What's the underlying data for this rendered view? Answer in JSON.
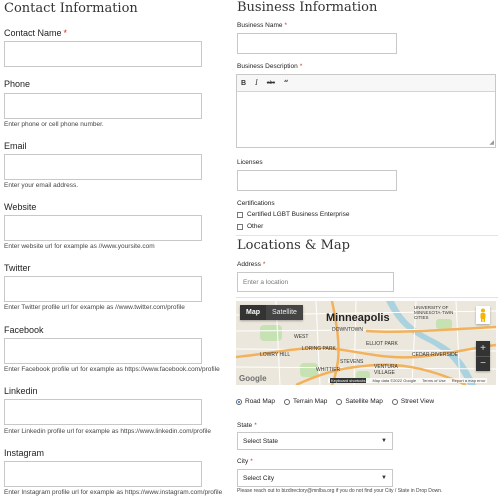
{
  "contact": {
    "heading": "Contact Information",
    "fields": [
      {
        "key": "name",
        "label": "Contact Name",
        "required": true,
        "help": ""
      },
      {
        "key": "phone",
        "label": "Phone",
        "required": false,
        "help": "Enter phone or cell phone number."
      },
      {
        "key": "email",
        "label": "Email",
        "required": false,
        "help": "Enter your email address."
      },
      {
        "key": "website",
        "label": "Website",
        "required": false,
        "help": "Enter website url for example as //www.yoursite.com"
      },
      {
        "key": "twitter",
        "label": "Twitter",
        "required": false,
        "help": "Enter Twitter profile url for example as //www.twitter.com/profile"
      },
      {
        "key": "facebook",
        "label": "Facebook",
        "required": false,
        "help": "Enter Facebook profile url for example as https://www.facebook.com/profile"
      },
      {
        "key": "linkedin",
        "label": "Linkedin",
        "required": false,
        "help": "Enter Linkedin profile url for example as https://www.linkedin.com/profile"
      },
      {
        "key": "instagram",
        "label": "Instagram",
        "required": false,
        "help": "Enter Instagram profile url for example as https://www.instagram.com/profile"
      }
    ]
  },
  "business": {
    "heading": "Business Information",
    "name_label": "Business Name",
    "description_label": "Business Description",
    "toolbar": {
      "bold": "B",
      "italic": "I",
      "strike": "abc",
      "quote": "66"
    },
    "licenses_label": "Licenses",
    "certifications_label": "Certifications",
    "certifications": [
      "Certified LGBT Business Enterprise",
      "Other"
    ]
  },
  "location": {
    "heading": "Locations & Map",
    "address_label": "Address",
    "address_placeholder": "Enter a location",
    "map": {
      "tab_map": "Map",
      "tab_satellite": "Satellite",
      "city": "Minneapolis",
      "places": [
        "DOWNTOWN",
        "WEST",
        "ELLIOT PARK",
        "LORING PARK",
        "LOWRY HILL",
        "CEDAR-RIVERSIDE",
        "UNIVERSITY OF MINNESOTA-TWIN CITIES",
        "MINNESOTA TWIN CITIES",
        "STEVENS",
        "WHITTIER",
        "VENTURA VILLAGE"
      ],
      "footer": [
        "Keyboard shortcuts",
        "Map data ©2022 Google",
        "Terms of Use",
        "Report a map error"
      ],
      "google": "Google",
      "zoom_in": "+",
      "zoom_out": "−"
    },
    "map_types": [
      "Road Map",
      "Terrain Map",
      "Satellite Map",
      "Street View"
    ],
    "map_type_selected": "Road Map",
    "state_label": "State",
    "state_value": "Select State",
    "city_label": "City",
    "city_value": "Select City",
    "city_help": "Please reach out to bizdirectory@mnlba.org if you do not find your City / State in Drop Down."
  },
  "colors": {
    "required": "#c0392b",
    "map_water": "#aad3df",
    "map_highway": "#f3b15b",
    "map_land": "#e8e4d8",
    "map_park": "#c6e2b3",
    "pegman": "#f4b400"
  },
  "icons": [
    "bold-icon",
    "italic-icon",
    "strikethrough-icon",
    "quote-icon",
    "resize-handle-icon",
    "pegman-icon",
    "zoom-in-icon",
    "zoom-out-icon",
    "dropdown-caret-icon"
  ]
}
